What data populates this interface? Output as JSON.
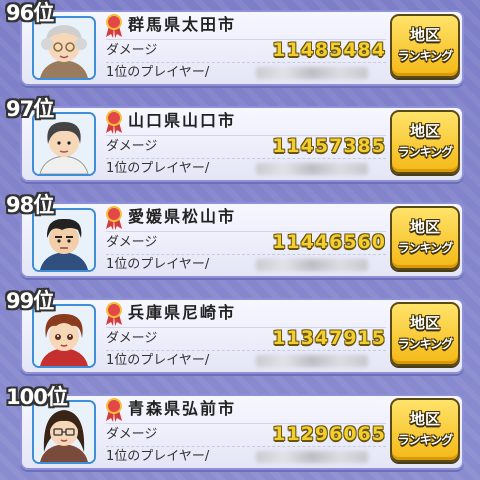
{
  "labels": {
    "damage": "ダメージ",
    "top_player": "1位のプレイヤー/",
    "button_line1": "地区",
    "button_line2": "ランキング"
  },
  "colors": {
    "background": "#8283cc",
    "card_border": "#8e91d8",
    "button_fill": "#f7c52a",
    "damage_value": "#f2cf2d",
    "avatar_border": "#3f8fd8"
  },
  "rows": [
    {
      "rank": "96位",
      "region": "群馬県太田市",
      "damage": "11485484",
      "avatar": "elderly-woman-avatar"
    },
    {
      "rank": "97位",
      "region": "山口県山口市",
      "damage": "11457385",
      "avatar": "woman-avatar"
    },
    {
      "rank": "98位",
      "region": "愛媛県松山市",
      "damage": "11446560",
      "avatar": "man-avatar"
    },
    {
      "rank": "99位",
      "region": "兵庫県尼崎市",
      "damage": "11347915",
      "avatar": "boy-avatar"
    },
    {
      "rank": "100位",
      "region": "青森県弘前市",
      "damage": "11296065",
      "avatar": "glasses-woman-avatar"
    }
  ]
}
